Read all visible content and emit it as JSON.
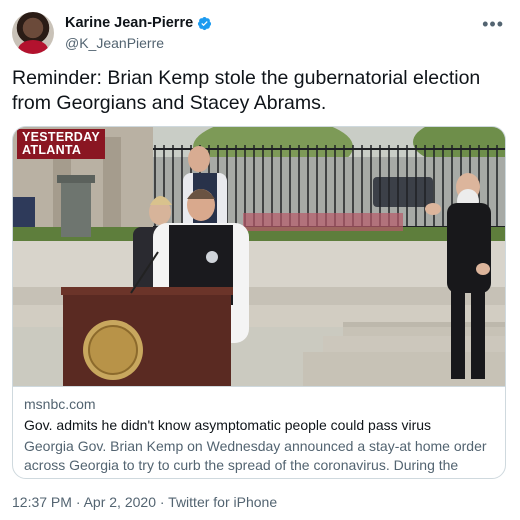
{
  "author": {
    "display_name": "Karine Jean-Pierre",
    "handle": "@K_JeanPierre",
    "verified": true
  },
  "tweet": {
    "text_line1": "Reminder: Brian Kemp stole the gubernatorial election",
    "text_line2": "from  Georgians and Stacey Abrams."
  },
  "card": {
    "badge_line1": "YESTERDAY",
    "badge_line2": "ATLANTA",
    "domain": "msnbc.com",
    "title": "Gov. admits he didn't know asymptomatic people could pass virus",
    "description": "Georgia Gov. Brian Kemp on Wednesday announced a stay-at home order across Georgia to try to curb the spread of the coronavirus. During the announcement..."
  },
  "meta": {
    "timestamp": "12:37 PM · Apr 2, 2020 · Twitter for iPhone"
  },
  "icons": {
    "verified": "verified-badge-icon",
    "more": "more-options-icon"
  },
  "colors": {
    "verified_blue": "#1d9bf0",
    "secondary_text": "#536471",
    "badge_red": "#8a1622"
  }
}
